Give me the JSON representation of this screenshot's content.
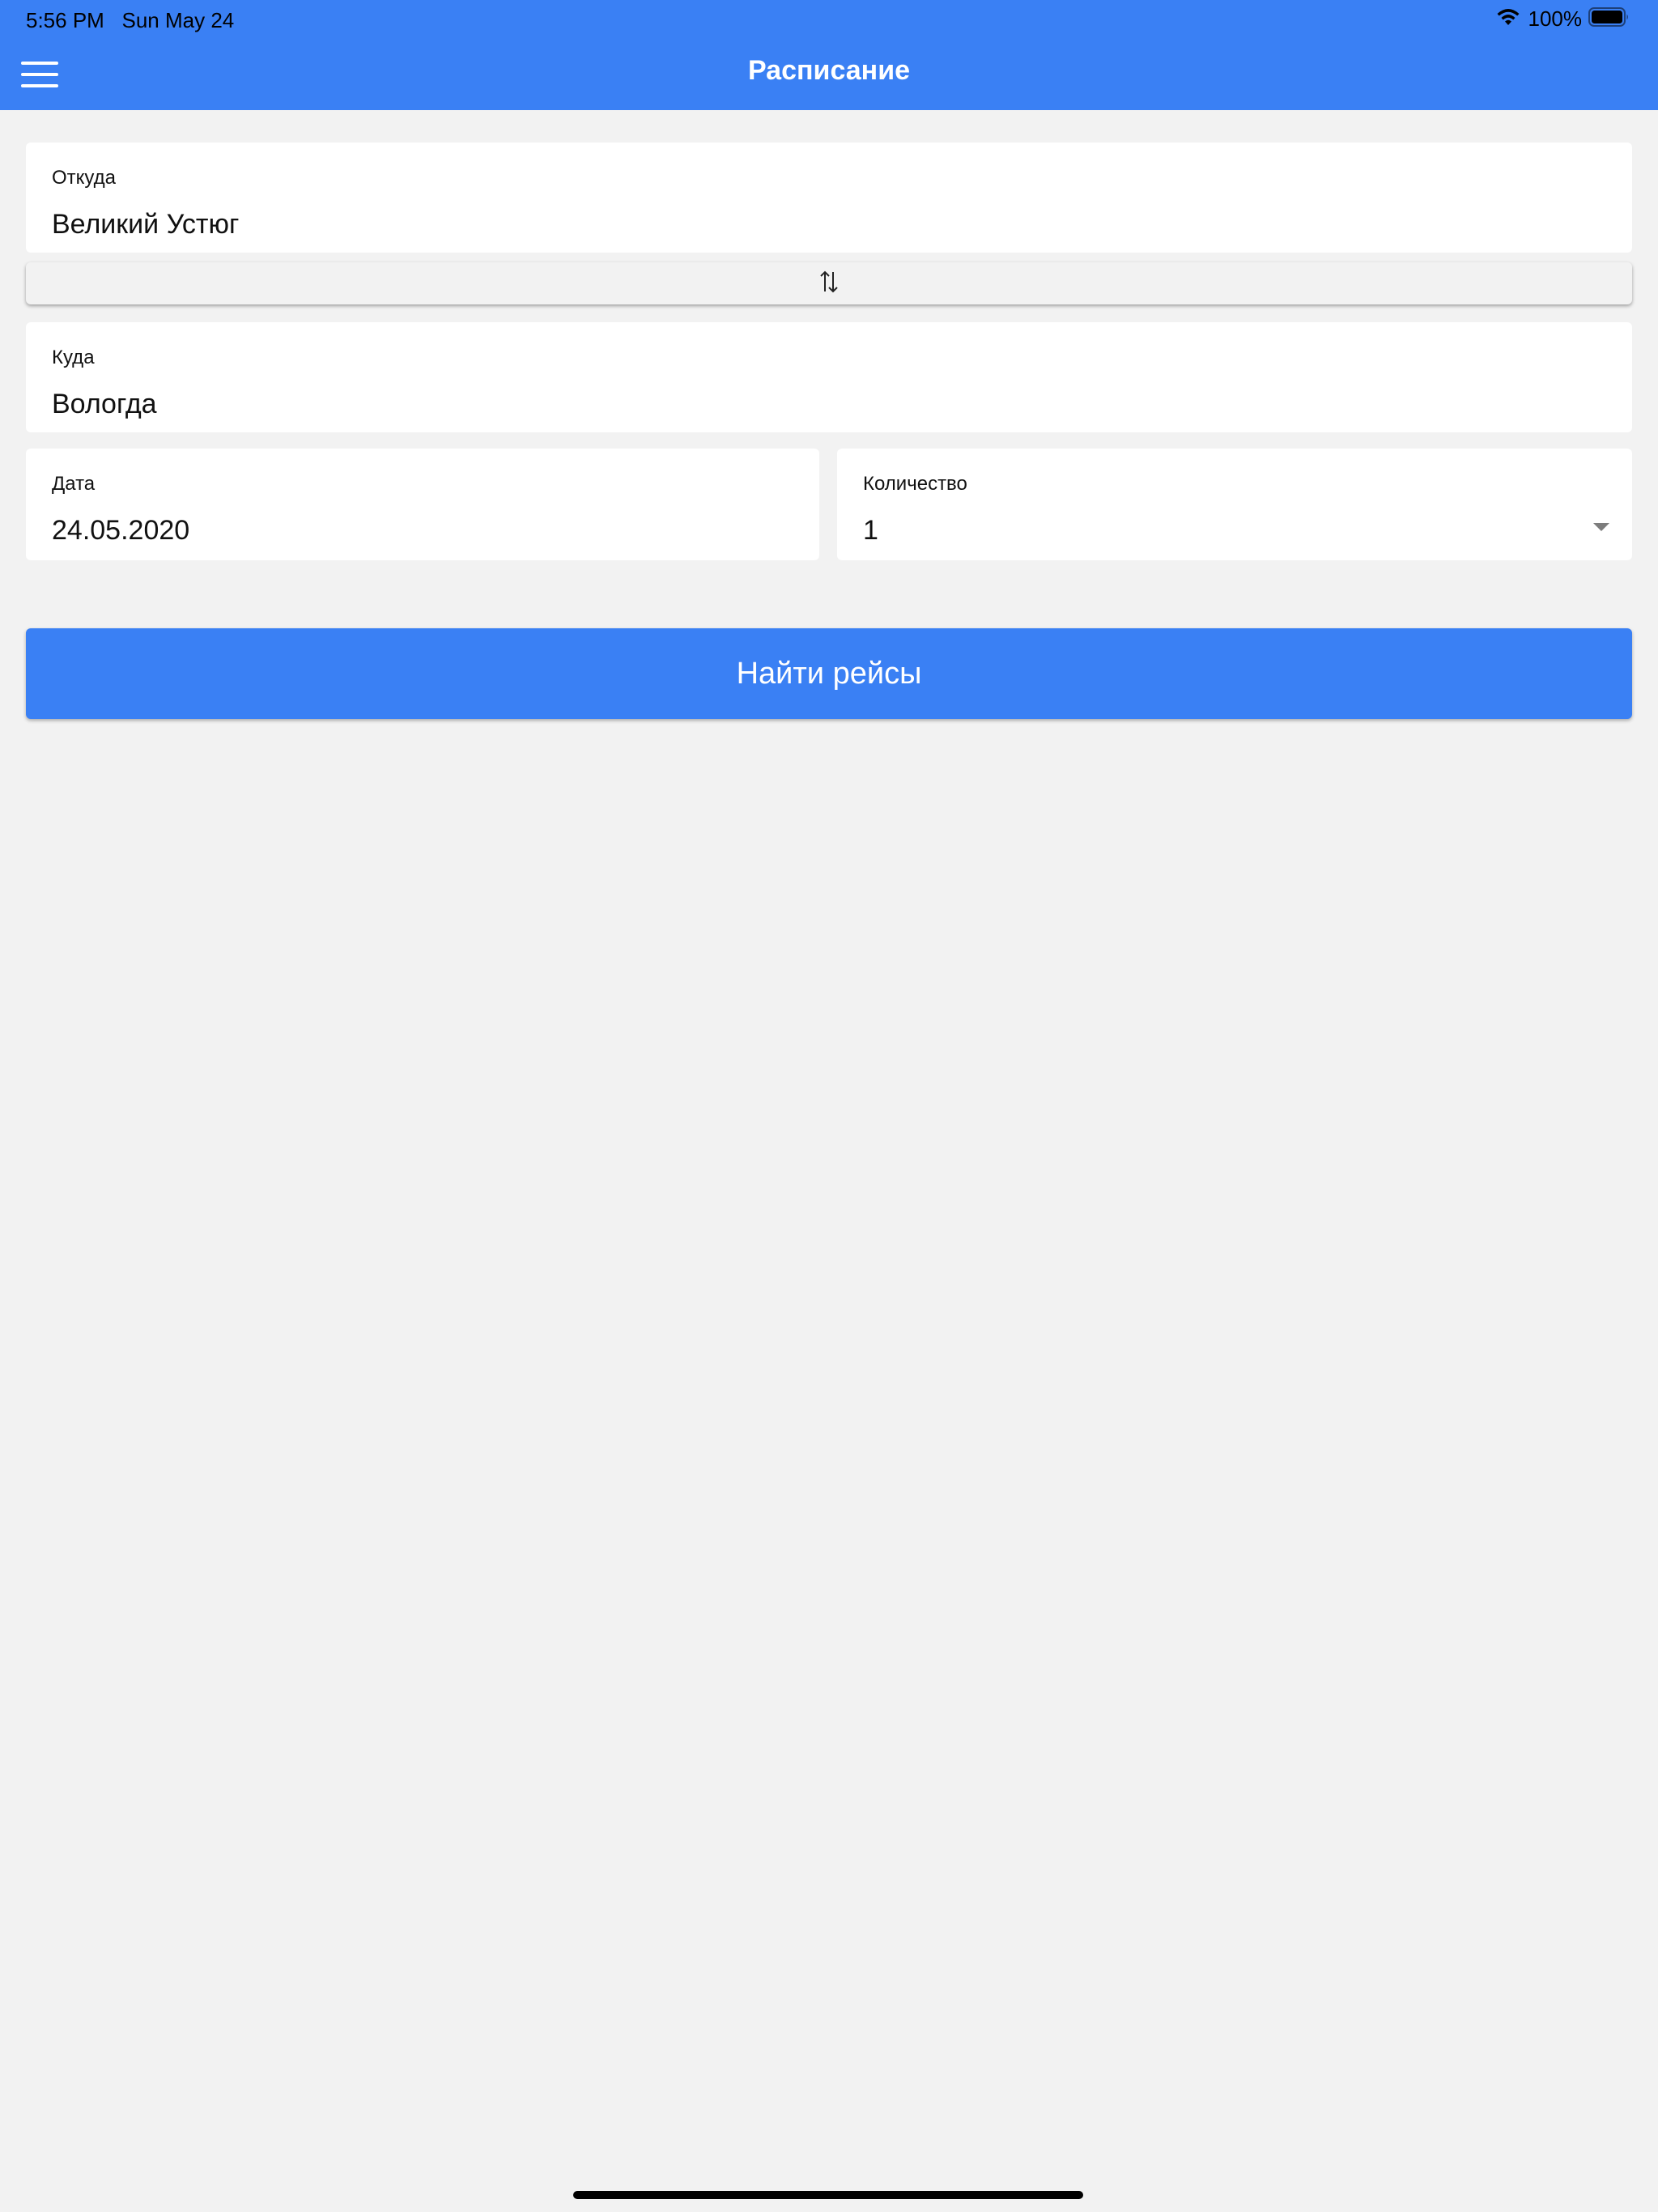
{
  "status_bar": {
    "time": "5:56 PM",
    "date": "Sun May 24",
    "battery": "100%",
    "wifi_icon": "wifi-icon",
    "battery_icon": "battery-icon"
  },
  "header": {
    "title": "Расписание",
    "menu_icon": "hamburger-menu-icon",
    "background": "#3a80f4"
  },
  "form": {
    "from": {
      "label": "Откуда",
      "value": "Великий Устюг"
    },
    "swap_icon": "swap-vertical-icon",
    "to": {
      "label": "Куда",
      "value": "Вологда"
    },
    "date": {
      "label": "Дата",
      "value": "24.05.2020"
    },
    "quantity": {
      "label": "Количество",
      "value": "1",
      "icon": "chevron-down-icon"
    },
    "search_button": "Найти рейсы"
  }
}
